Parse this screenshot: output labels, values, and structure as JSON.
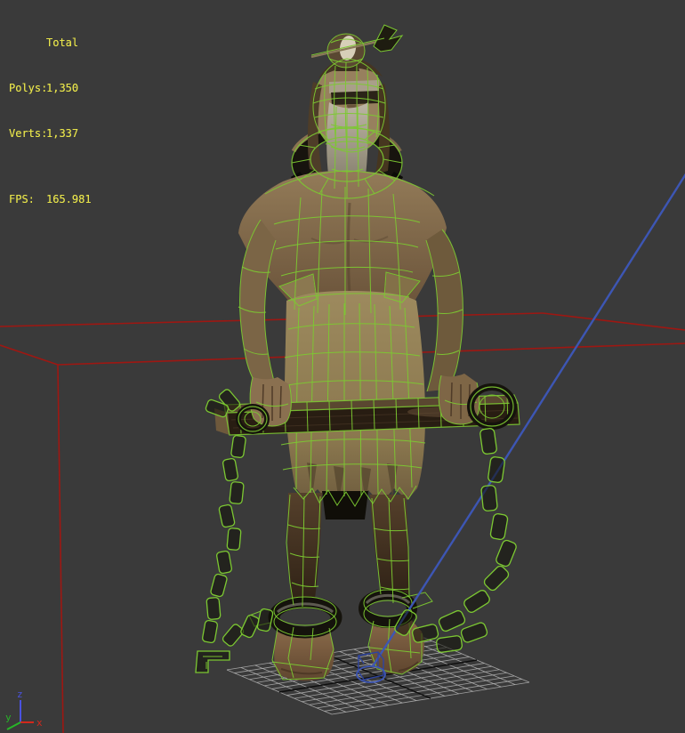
{
  "stats": {
    "total_label": "Total",
    "polys_label": "Polys:",
    "polys_value": "1,350",
    "verts_label": "Verts:",
    "verts_value": "1,337",
    "fps_label": "FPS:",
    "fps_value": "165.981"
  },
  "axis_gizmo": {
    "x": "x",
    "y": "y",
    "z": "z"
  },
  "colors": {
    "background": "#3a3a3a",
    "stats_text": "#e6e24a",
    "wireframe_green": "#7cc832",
    "reference_box_red": "#9e1712",
    "bone_line_blue": "#3d56b4",
    "grid_gray": "#b5b5b5",
    "grid_axis_dark": "#0d0d0d",
    "axis_x_red": "#d2281c",
    "axis_y_green": "#28b428",
    "axis_z_blue": "#4a52e0"
  },
  "scene_objects": {
    "model": "character-mesh",
    "prop": "wooden-beam-with-chains",
    "restraints": "ankle-shackles",
    "ground": "home-grid",
    "reference": "red-reference-box",
    "bone": "blue-bone-line",
    "helper": "blue-helper-object",
    "gizmo": "world-axis-tripod"
  }
}
